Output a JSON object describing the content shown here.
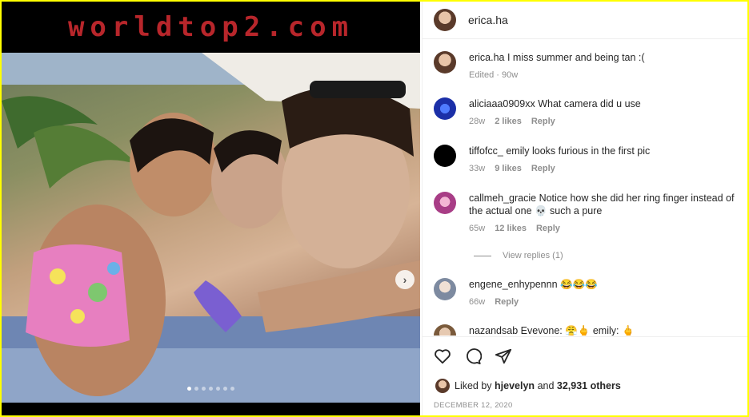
{
  "banner": {
    "text": "worldtop2.com"
  },
  "carousel": {
    "dot_count": 7,
    "active_index": 0,
    "next_icon": "chevron-right-icon"
  },
  "header": {
    "username": "erica.ha"
  },
  "caption": {
    "username": "erica.ha",
    "text": "I miss summer and being tan :(",
    "meta": "Edited · 90w"
  },
  "comments": [
    {
      "username": "aliciaaa0909xx",
      "text": "What camera did u use",
      "time": "28w",
      "likes": "2 likes",
      "reply": "Reply"
    },
    {
      "username": "tiffofcc_",
      "text": "emily looks furious in the first pic",
      "time": "33w",
      "likes": "9 likes",
      "reply": "Reply"
    },
    {
      "username": "callmeh_gracie",
      "text": "Notice how she did her ring finger instead of the actual one 💀 such a pure",
      "time": "65w",
      "likes": "12 likes",
      "reply": "Reply"
    },
    {
      "username": "engene_enhypennn",
      "text": "😂😂😂",
      "time": "66w",
      "reply": "Reply"
    },
    {
      "username": "nazandsab",
      "text": "Evevone: 😤🖕 emily: 🖕"
    }
  ],
  "view_replies": "View replies (1)",
  "actions": {
    "like_icon": "heart-icon",
    "comment_icon": "comment-icon",
    "share_icon": "share-icon"
  },
  "likes": {
    "prefix": "Liked by",
    "user": "hjevelyn",
    "middle": "and",
    "count": "32,931 others"
  },
  "date": "DECEMBER 12, 2020"
}
